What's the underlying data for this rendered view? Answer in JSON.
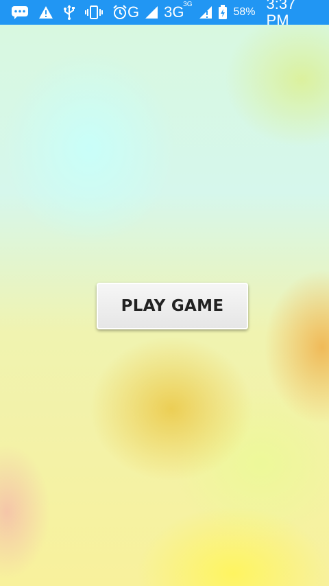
{
  "status_bar": {
    "background_color": "#2196f3",
    "icons_left": [
      "chat-bubble-icon",
      "warning-icon",
      "usb-icon",
      "vibrate-icon",
      "alarm-icon"
    ],
    "network_type_1": "G",
    "network_type_2": "3G",
    "network_type_2_sup": "3G",
    "battery_percent": "58%",
    "time": "3:37 PM"
  },
  "main": {
    "play_button_label": "PLAY GAME"
  }
}
